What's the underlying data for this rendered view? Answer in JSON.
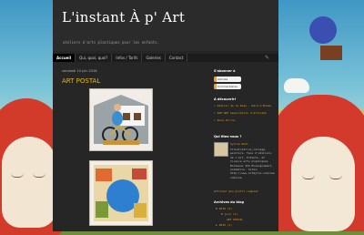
{
  "blog": {
    "title": "L'instant À p' Art",
    "tagline": "ateliers d'arts plastiques pour les enfants."
  },
  "nav": {
    "tabs": [
      "Accueil",
      "Qui, quoi, quoi?",
      "Infos / Tarifs",
      "Galeries",
      "Contact"
    ]
  },
  "post": {
    "date": "vendredi 10 juin 2016",
    "title": "ART POSTAL"
  },
  "sidebar": {
    "follow_heading": "S'abonner à",
    "follow_items": [
      "Articles",
      "Commentaires"
    ],
    "discover_heading": "A découvrir!",
    "discover_links": [
      "Atelier de la Rose - Pain'e'Roses",
      "ZAP'ART association d'artistes",
      "Zona Zirino"
    ],
    "about_heading": "Qui êtes-vous ?",
    "profile_name": "Sylvie Rodi",
    "profile_bio": "Illustratrice,collage, peinture. Tenu d'ateliers de l'art, Enfants, et licence arts plastiques Bordeaux III.Enseignement, animation. Sites: http://www.artmylie.com/zaa ndalise",
    "profile_link": "Afficher mon profil complet",
    "archive_heading": "Archives du blog",
    "archive_items": [
      "2016 (1)",
      "juin (1)",
      "ART POSTAL",
      "2015 (1)"
    ]
  }
}
